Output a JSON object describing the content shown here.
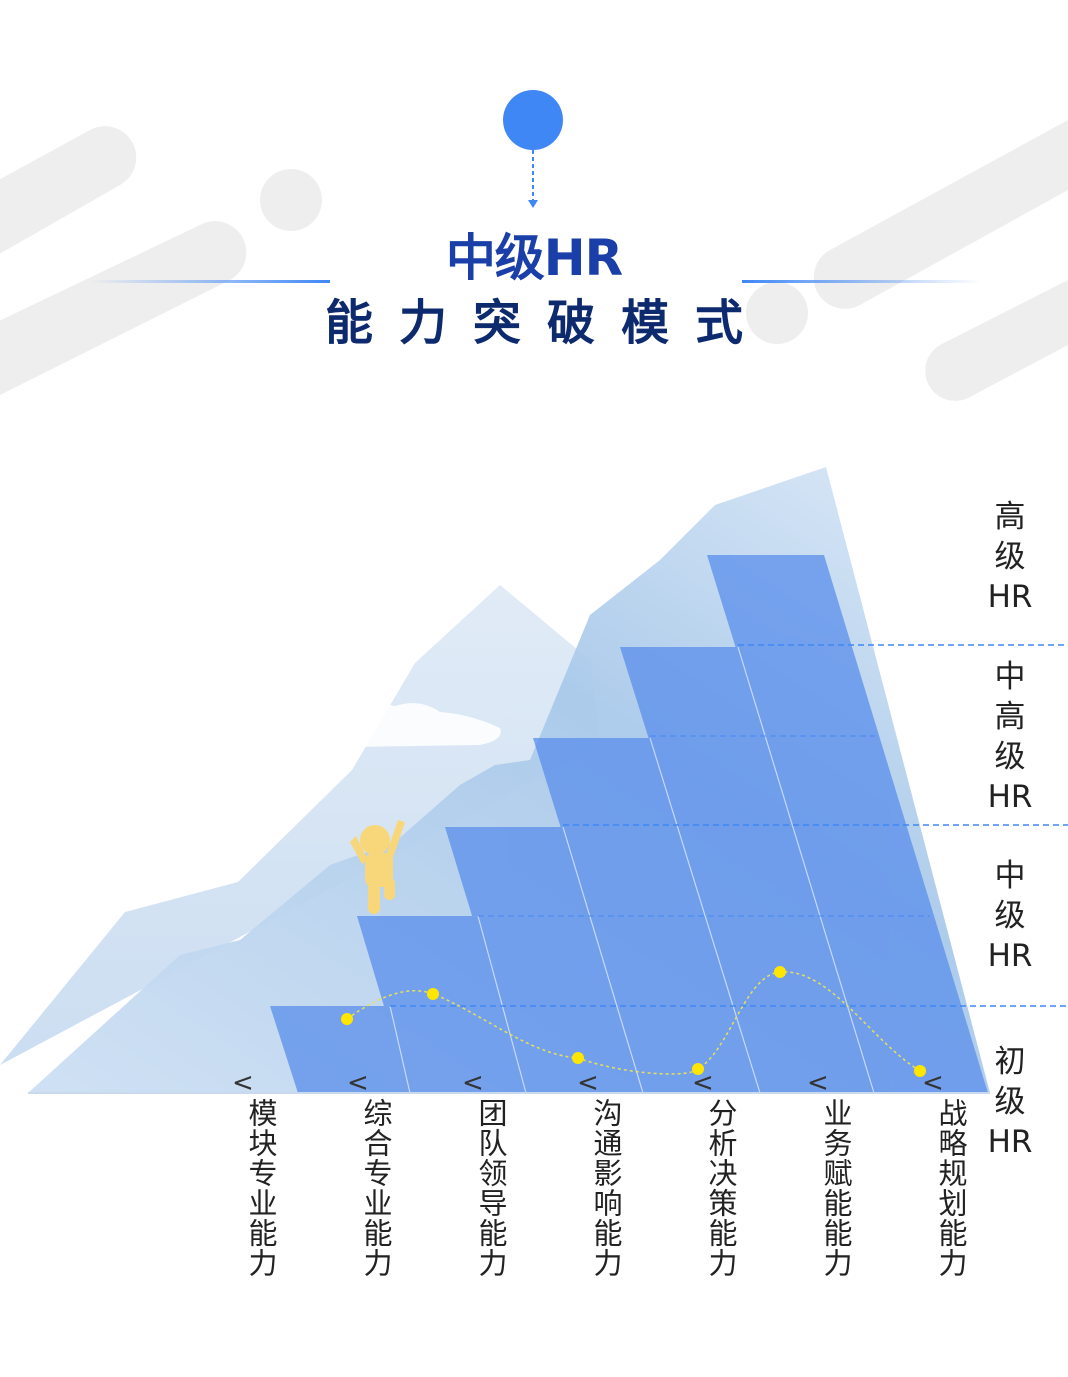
{
  "title": "中级HR",
  "subtitle": "能力突破模式",
  "levels": [
    {
      "name": "高级HR",
      "chars": [
        "高",
        "级",
        "HR"
      ]
    },
    {
      "name": "中高级HR",
      "chars": [
        "中",
        "高",
        "级",
        "HR"
      ]
    },
    {
      "name": "中级HR",
      "chars": [
        "中",
        "级",
        "HR"
      ]
    },
    {
      "name": "初级HR",
      "chars": [
        "初",
        "级",
        "HR"
      ]
    }
  ],
  "skills": [
    "模块专业能力",
    "综合专业能力",
    "团队领导能力",
    "沟通影响能力",
    "分析决策能力",
    "业务赋能能力",
    "战略规划能力"
  ],
  "caret_symbol": "<",
  "colors": {
    "accent": "#3f87f5",
    "title": "#1a3fa8",
    "subtitle": "#0d2a6e",
    "steps": "#6f9ff0",
    "curve_dots": "#ffe600",
    "person": "#f7d77a"
  }
}
